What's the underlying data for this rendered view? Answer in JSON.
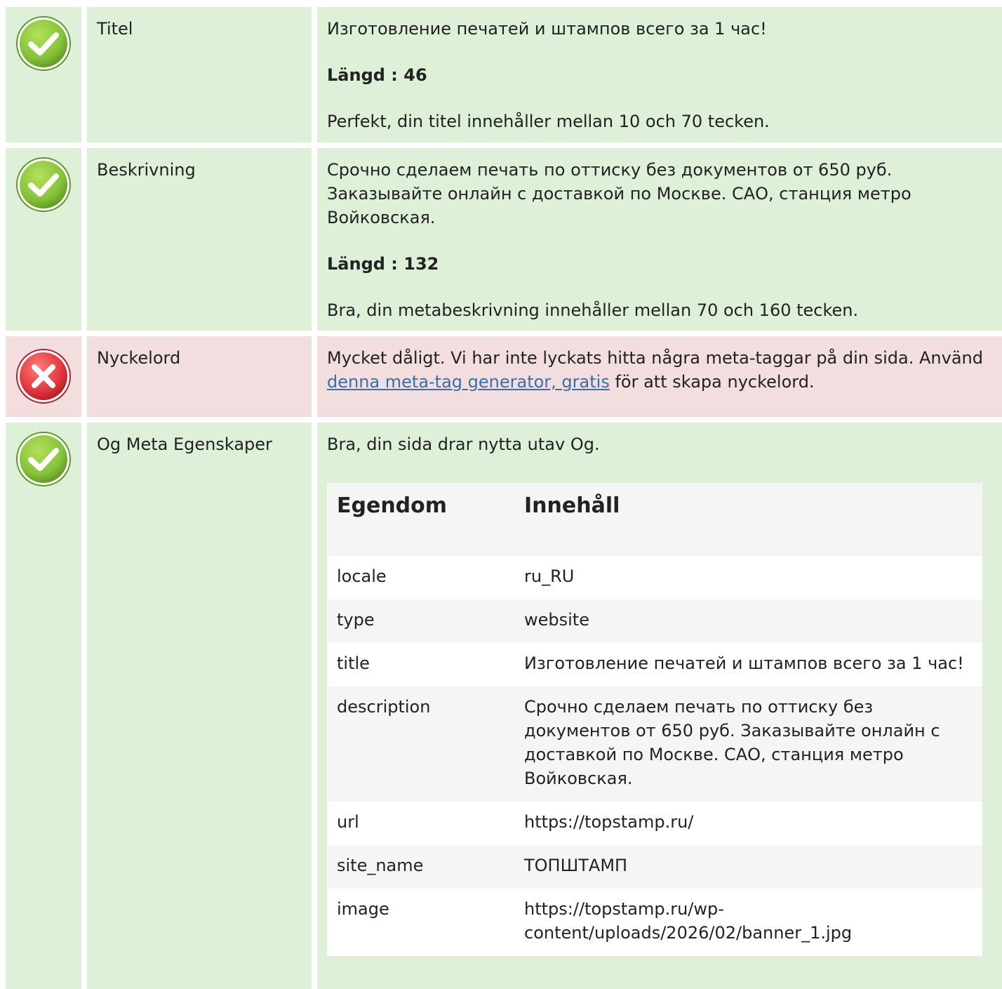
{
  "colors": {
    "good_bg": "#dff0d8",
    "bad_bg": "#f2dede",
    "check_green": "#8cc63f",
    "cross_red": "#e2373f",
    "link": "#3a6ea5"
  },
  "rows": {
    "title": {
      "status_icon": "check-icon",
      "label": "Titel",
      "value": "Изготовление печатей и штампов всего за 1 час!",
      "length": "Längd : 46",
      "verdict": "Perfekt, din titel innehåller mellan 10 och 70 tecken."
    },
    "description": {
      "status_icon": "check-icon",
      "label": "Beskrivning",
      "value": "Срочно сделаем печать по оттиску без документов от 650 руб. Заказывайте онлайн с доставкой по Москве. САО, станция метро Войковская.",
      "length": "Längd : 132",
      "verdict": "Bra, din metabeskrivning innehåller mellan 70 och 160 tecken."
    },
    "keywords": {
      "status_icon": "cross-icon",
      "label": "Nyckelord",
      "text_before": "Mycket dåligt. Vi har inte lyckats hitta några meta-taggar på din sida. Använd ",
      "link_text": "denna meta-tag generator, gratis",
      "text_after": " för att skapa nyckelord."
    },
    "og": {
      "status_icon": "check-icon",
      "label": "Og Meta Egenskaper",
      "verdict": "Bra, din sida drar nytta utav Og.",
      "table_headers": {
        "property": "Egendom",
        "content": "Innehåll"
      },
      "table_rows": [
        {
          "property": "locale",
          "content": "ru_RU"
        },
        {
          "property": "type",
          "content": "website"
        },
        {
          "property": "title",
          "content": "Изготовление печатей и штампов всего за 1 час!"
        },
        {
          "property": "description",
          "content": "Срочно сделаем печать по оттиску без документов от 650 руб. Заказывайте онлайн с доставкой по Москве. САО, станция метро Войковская."
        },
        {
          "property": "url",
          "content": "https://topstamp.ru/"
        },
        {
          "property": "site_name",
          "content": "ТОПШТАМП"
        },
        {
          "property": "image",
          "content": "https://topstamp.ru/wp-content/uploads/2026/02/banner_1.jpg"
        }
      ]
    }
  }
}
